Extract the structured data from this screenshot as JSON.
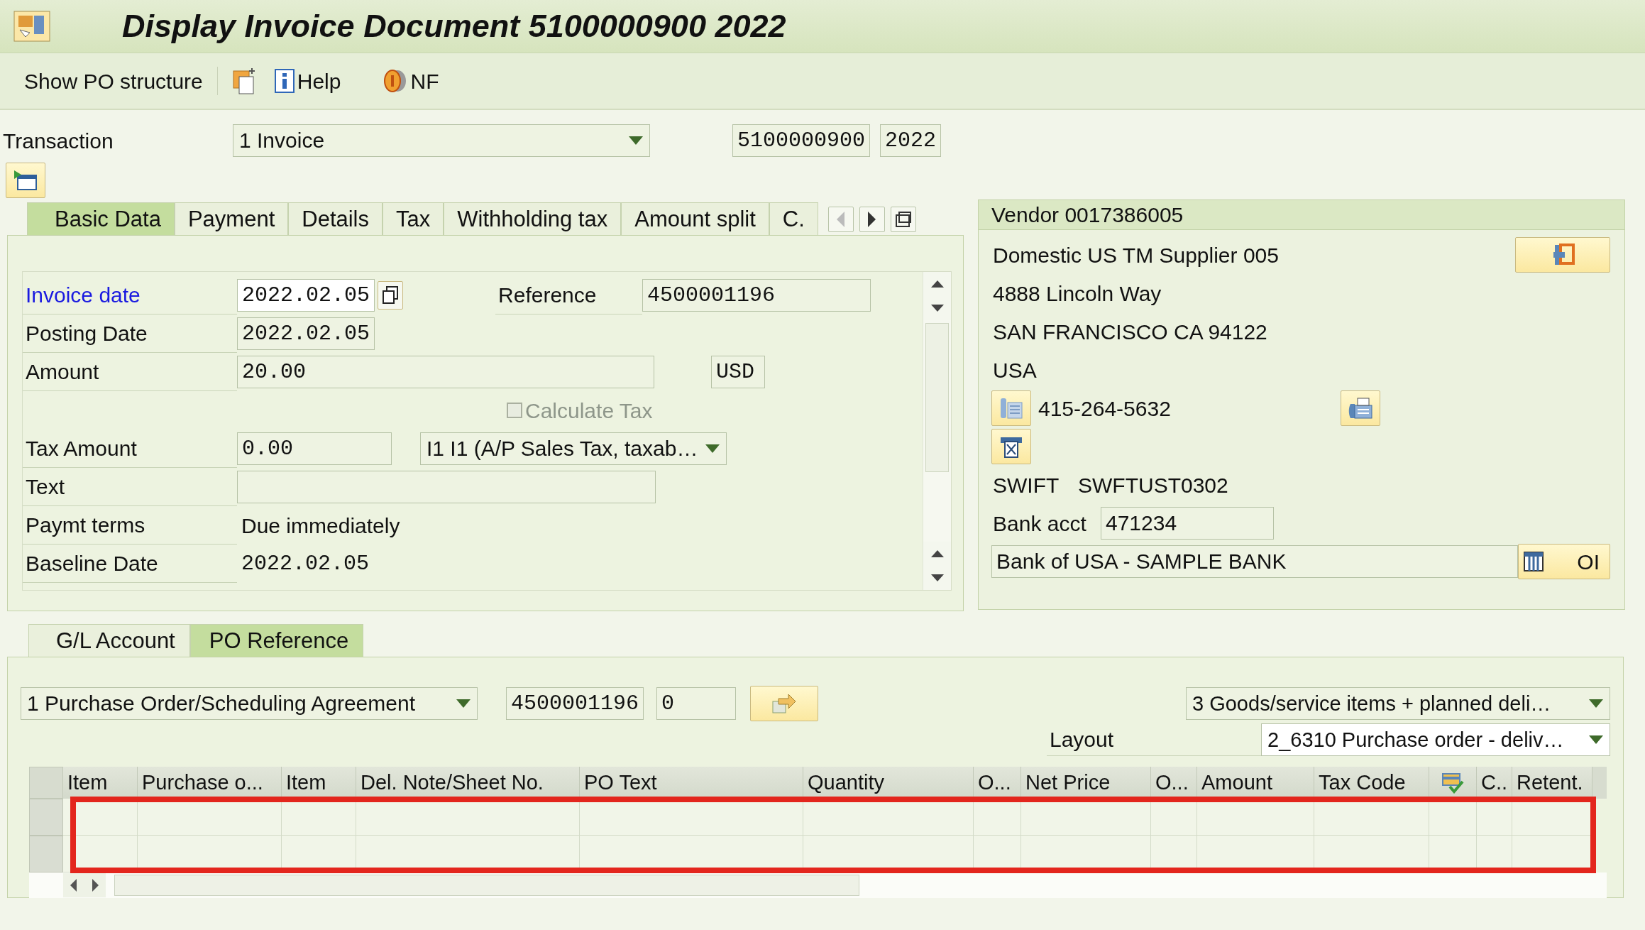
{
  "window": {
    "title": "Display Invoice Document 5100000900 2022"
  },
  "toolbar": [
    {
      "kind": "text",
      "label": "Show PO structure"
    },
    {
      "kind": "icon"
    },
    {
      "kind": "icon-text",
      "label": "Help"
    },
    {
      "kind": "icon-text",
      "label": "NF"
    }
  ],
  "transaction": {
    "label": "Transaction",
    "value": "1 Invoice",
    "document_number": "5100000900",
    "year": "2022"
  },
  "header_tabs": [
    {
      "label": "Basic Data",
      "selected": true
    },
    {
      "label": "Payment",
      "selected": false
    },
    {
      "label": "Details",
      "selected": false
    },
    {
      "label": "Tax",
      "selected": false
    },
    {
      "label": "Withholding tax",
      "selected": false
    },
    {
      "label": "Amount split",
      "selected": false
    },
    {
      "label": "C.",
      "selected": false
    }
  ],
  "basic_data": {
    "invoice_date": {
      "label": "Invoice date",
      "link": true,
      "value": "2022.02.05"
    },
    "reference": {
      "label": "Reference",
      "value": "4500001196"
    },
    "posting_date": {
      "label": "Posting Date",
      "value": "2022.02.05"
    },
    "amount": {
      "label": "Amount",
      "value": "20.00",
      "currency": "USD"
    },
    "calculate_tax": {
      "label": "Calculate Tax",
      "checked": false,
      "disabled": true
    },
    "tax_amount": {
      "label": "Tax Amount",
      "value": "0.00"
    },
    "tax_code": {
      "value": "I1 I1 (A/P Sales Tax, taxab…"
    },
    "text": {
      "label": "Text"
    },
    "payment_terms": {
      "label": "Paymt terms",
      "value": "Due immediately"
    },
    "baseline_date": {
      "label": "Baseline Date",
      "value": "2022.02.05"
    }
  },
  "vendor": {
    "title": "Vendor 0017386005",
    "name": "Domestic US TM Supplier 005",
    "street": "4888 Lincoln Way",
    "city": "SAN FRANCISCO CA  94122",
    "country": "USA",
    "phone": "415-264-5632",
    "swift": {
      "label": "SWIFT",
      "value": "SWFTUST0302"
    },
    "bank_acct": {
      "label": "Bank acct",
      "value": "471234"
    },
    "bank_name": "Bank of USA - SAMPLE BANK",
    "bank_button": "OI"
  },
  "item_tabs": [
    {
      "label": "G/L Account",
      "selected": false
    },
    {
      "label": "PO Reference",
      "selected": true
    }
  ],
  "po_reference": {
    "document_type": "1 Purchase Order/Scheduling Agreement",
    "po_number": "4500001196",
    "item": "0",
    "item_selection": "3 Goods/service items + planned deli…",
    "layout": {
      "label": "Layout",
      "value": "2_6310 Purchase order - deliv…"
    }
  },
  "po_table": {
    "highlight": true,
    "columns": [
      {
        "label": "Item"
      },
      {
        "label": "Purchase o..."
      },
      {
        "label": "Item"
      },
      {
        "label": "Del. Note/Sheet No."
      },
      {
        "label": "PO Text"
      },
      {
        "label": "Quantity"
      },
      {
        "label": "O..."
      },
      {
        "label": "Net Price"
      },
      {
        "label": "O..."
      },
      {
        "label": "Amount"
      },
      {
        "label": "Tax Code"
      },
      {
        "kind": "icon"
      },
      {
        "label": "C.."
      },
      {
        "label": "Retent."
      }
    ]
  }
}
